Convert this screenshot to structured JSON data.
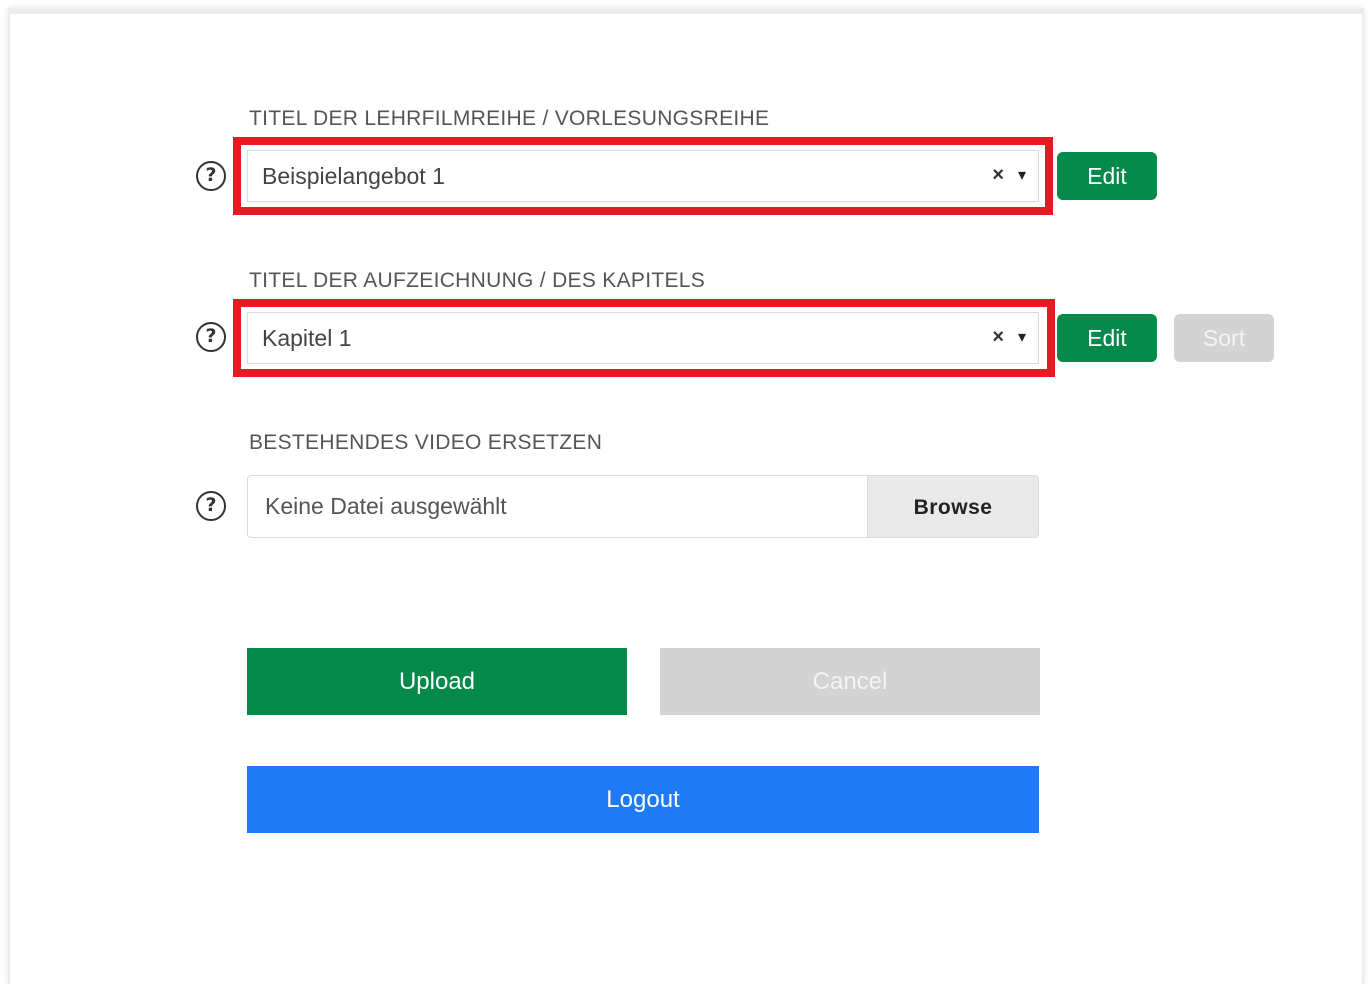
{
  "series_field": {
    "label": "TITEL DER LEHRFILMREIHE / VORLESUNGSREIHE",
    "value": "Beispielangebot 1",
    "clear_glyph": "×",
    "arrow_glyph": "▾",
    "edit_label": "Edit"
  },
  "chapter_field": {
    "label": "TITEL DER AUFZEICHNUNG / DES KAPITELS",
    "value": "Kapitel 1",
    "clear_glyph": "×",
    "arrow_glyph": "▾",
    "edit_label": "Edit",
    "sort_label": "Sort"
  },
  "video_field": {
    "label": "BESTEHENDES VIDEO ERSETZEN",
    "file_status": "Keine Datei ausgewählt",
    "browse_label": "Browse"
  },
  "help_glyph": "?",
  "actions": {
    "upload_label": "Upload",
    "cancel_label": "Cancel",
    "logout_label": "Logout"
  },
  "colors": {
    "highlight": "#e41b23",
    "primary_green": "#038a4b",
    "disabled_grey": "#d3d3d3",
    "logout_blue": "#1f7af5"
  }
}
